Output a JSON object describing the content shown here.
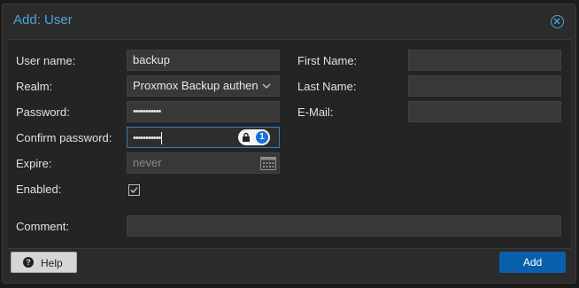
{
  "dialog": {
    "title": "Add: User"
  },
  "form": {
    "username": {
      "label": "User name:",
      "value": "backup"
    },
    "realm": {
      "label": "Realm:",
      "value": "Proxmox Backup authen"
    },
    "password": {
      "label": "Password:",
      "value": "•••••••••••"
    },
    "confirm_password": {
      "label": "Confirm password:",
      "value": "•••••••••••"
    },
    "expire": {
      "label": "Expire:",
      "placeholder": "never"
    },
    "enabled": {
      "label": "Enabled:",
      "checked": true
    },
    "first_name": {
      "label": "First Name:",
      "value": ""
    },
    "last_name": {
      "label": "Last Name:",
      "value": ""
    },
    "email": {
      "label": "E-Mail:",
      "value": ""
    },
    "comment": {
      "label": "Comment:",
      "value": ""
    }
  },
  "footer": {
    "help_label": "Help",
    "add_label": "Add"
  },
  "colors": {
    "accent": "#4aa3df",
    "primary_button": "#0a5fad"
  },
  "icons": [
    "close-icon",
    "chevron-down-icon",
    "calendar-icon",
    "lock-icon",
    "password-manager-icon",
    "checkmark-icon",
    "help-icon"
  ]
}
